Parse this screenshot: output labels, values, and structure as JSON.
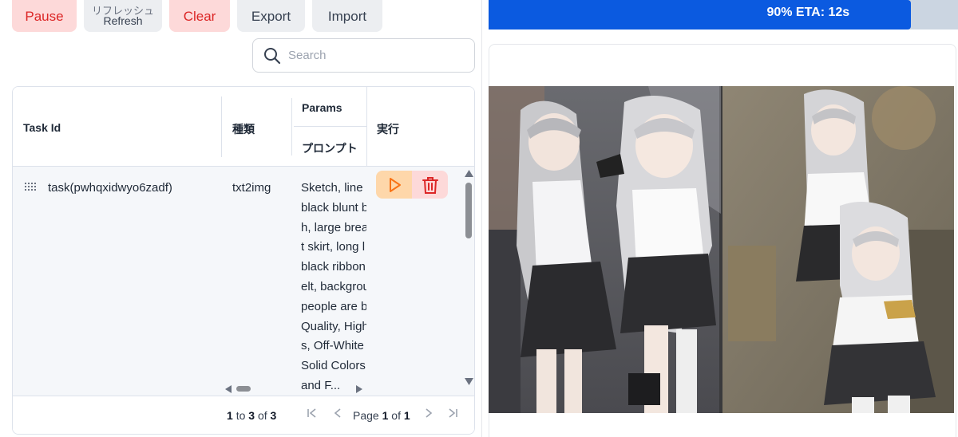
{
  "toolbar": {
    "pause_label": "Pause",
    "refresh_jp_label": "リフレッシュ",
    "refresh_label": "Refresh",
    "clear_label": "Clear",
    "export_label": "Export",
    "import_label": "Import"
  },
  "search": {
    "placeholder": "Search",
    "value": ""
  },
  "table": {
    "headers": {
      "task_id": "Task Id",
      "type": "種類",
      "params_group": "Params",
      "prompt": "プロンプト",
      "actions": "実行"
    },
    "rows": [
      {
        "task_id": "task(pwhqxidwyo6zadf)",
        "type": "txt2img",
        "prompt_lines": [
          "Sketch, line",
          "black blunt b",
          "h, large brea",
          "t skirt, long l",
          "black ribbon",
          "elt, backgrou",
          "people are b",
          "Quality, High",
          "s, Off-White",
          "Solid Colors",
          "and F..."
        ]
      }
    ]
  },
  "pagination": {
    "from": "1",
    "to_word": "to",
    "to": "3",
    "of_word": "of",
    "total": "3",
    "page_word": "Page",
    "page": "1",
    "page_of_word": "of",
    "page_total": "1",
    "first_icon": "first-page-icon",
    "prev_icon": "previous-page-icon",
    "next_icon": "next-page-icon",
    "last_icon": "last-page-icon"
  },
  "progress": {
    "fraction": 0.9,
    "text": "90% ETA: 12s"
  },
  "preview": {
    "image": "generated-anime-image"
  },
  "colors": {
    "accent_blue": "#0b5ae0",
    "danger_red": "#dc2626",
    "run_orange": "#f97316"
  }
}
